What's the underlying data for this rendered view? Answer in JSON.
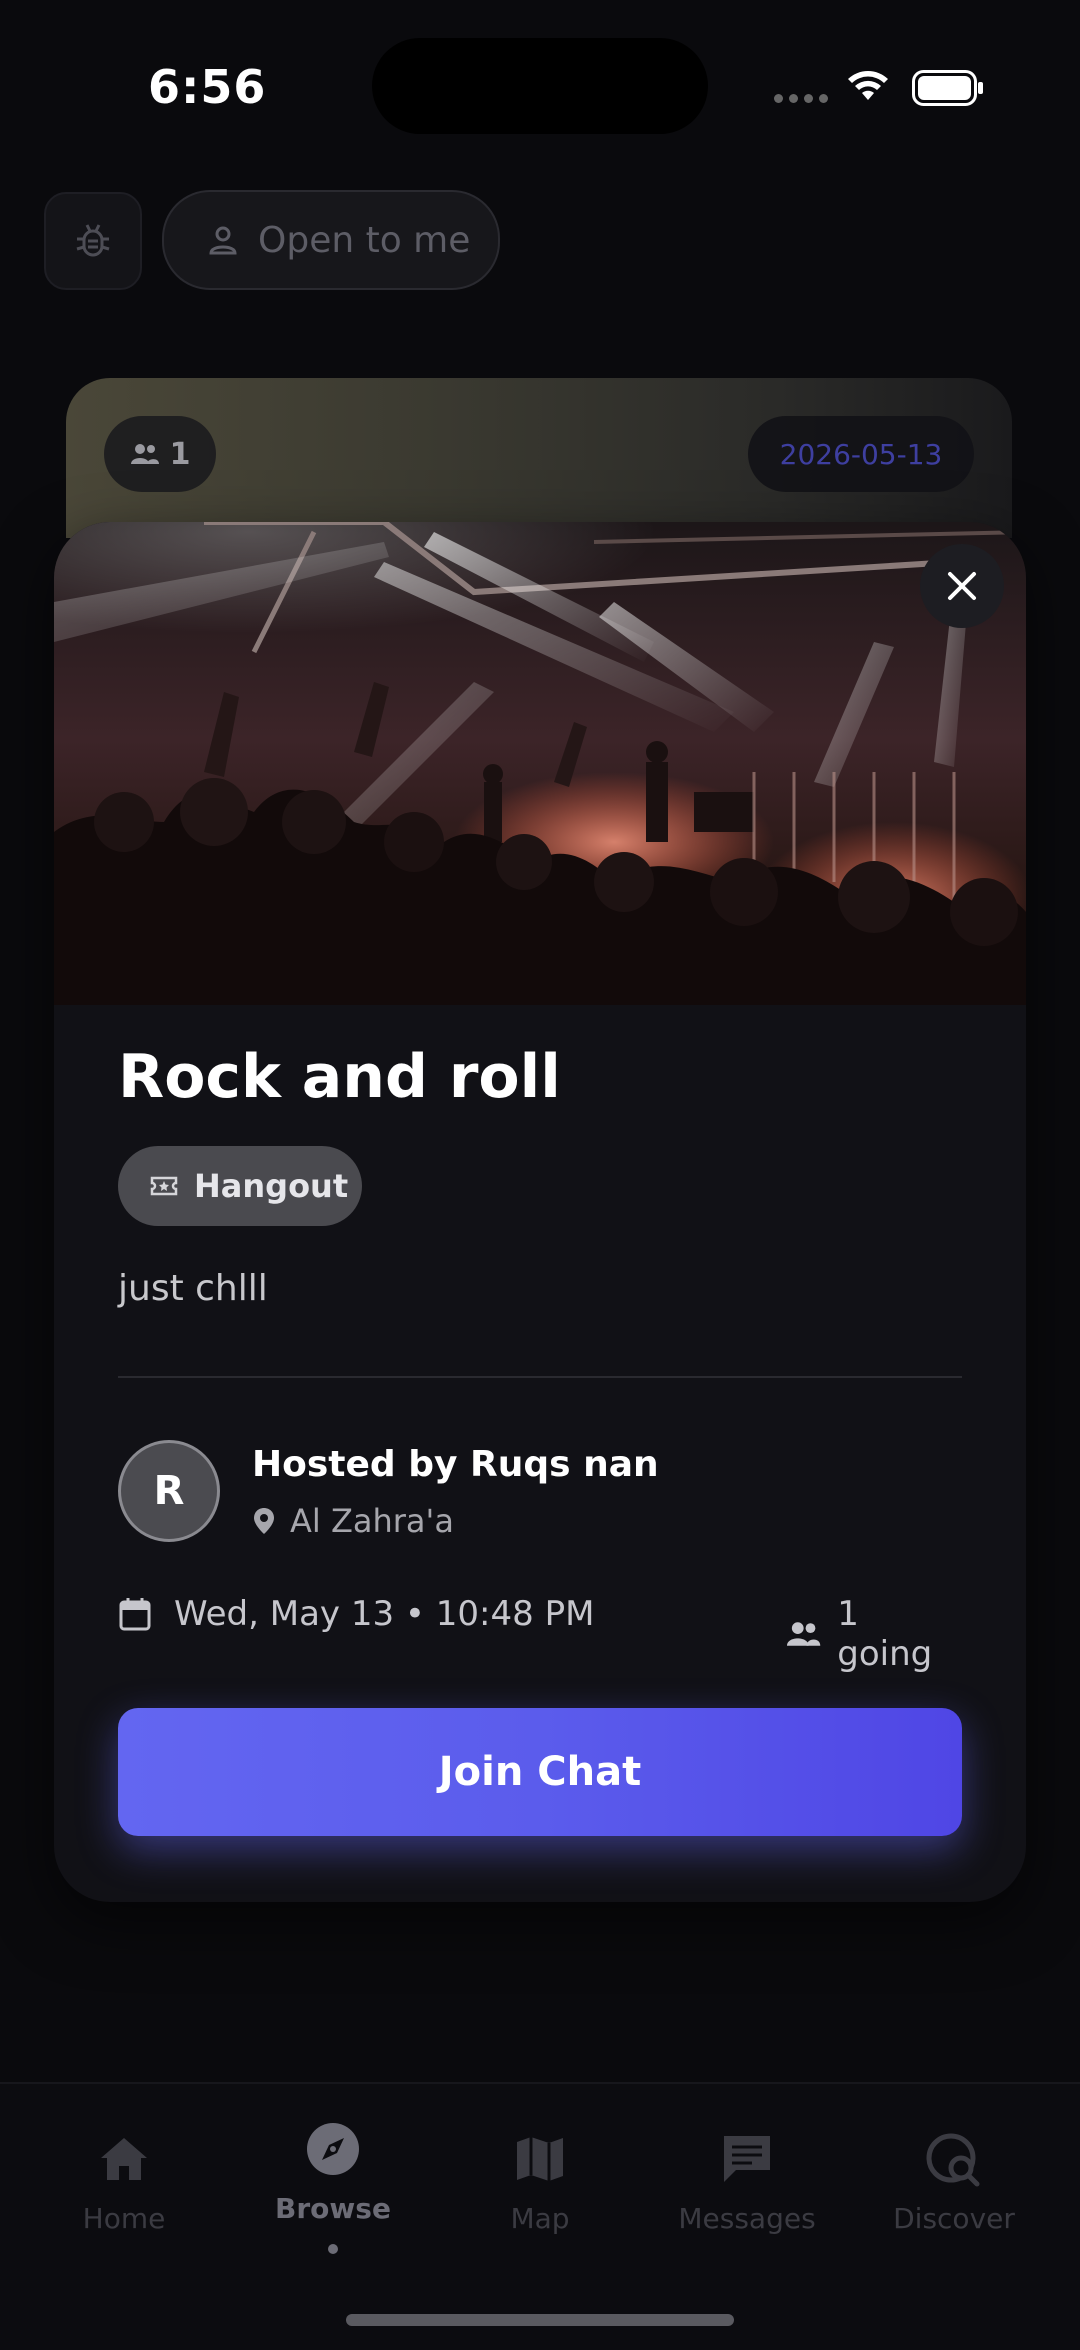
{
  "status_bar": {
    "time": "6:56"
  },
  "filters": {
    "open_label": "Open to me"
  },
  "background_card": {
    "attendee_count": "1",
    "date": "2026-05-13"
  },
  "event": {
    "title": "Rock and roll",
    "category": "Hangout",
    "description": "just chlll",
    "host": "Hosted by Ruqs nan",
    "host_initial": "R",
    "location": "Al Zahra'a",
    "datetime": "Wed, May 13 • 10:48 PM",
    "going": "1 going",
    "join_label": "Join Chat"
  },
  "tabs": [
    {
      "label": "Home",
      "icon": "home-icon"
    },
    {
      "label": "Browse",
      "icon": "compass-icon",
      "active": true
    },
    {
      "label": "Map",
      "icon": "map-icon"
    },
    {
      "label": "Messages",
      "icon": "chat-icon"
    },
    {
      "label": "Discover",
      "icon": "discover-icon"
    }
  ],
  "colors": {
    "accent": "#6366f1",
    "background": "#0a0a0d",
    "modal": "#111116"
  }
}
